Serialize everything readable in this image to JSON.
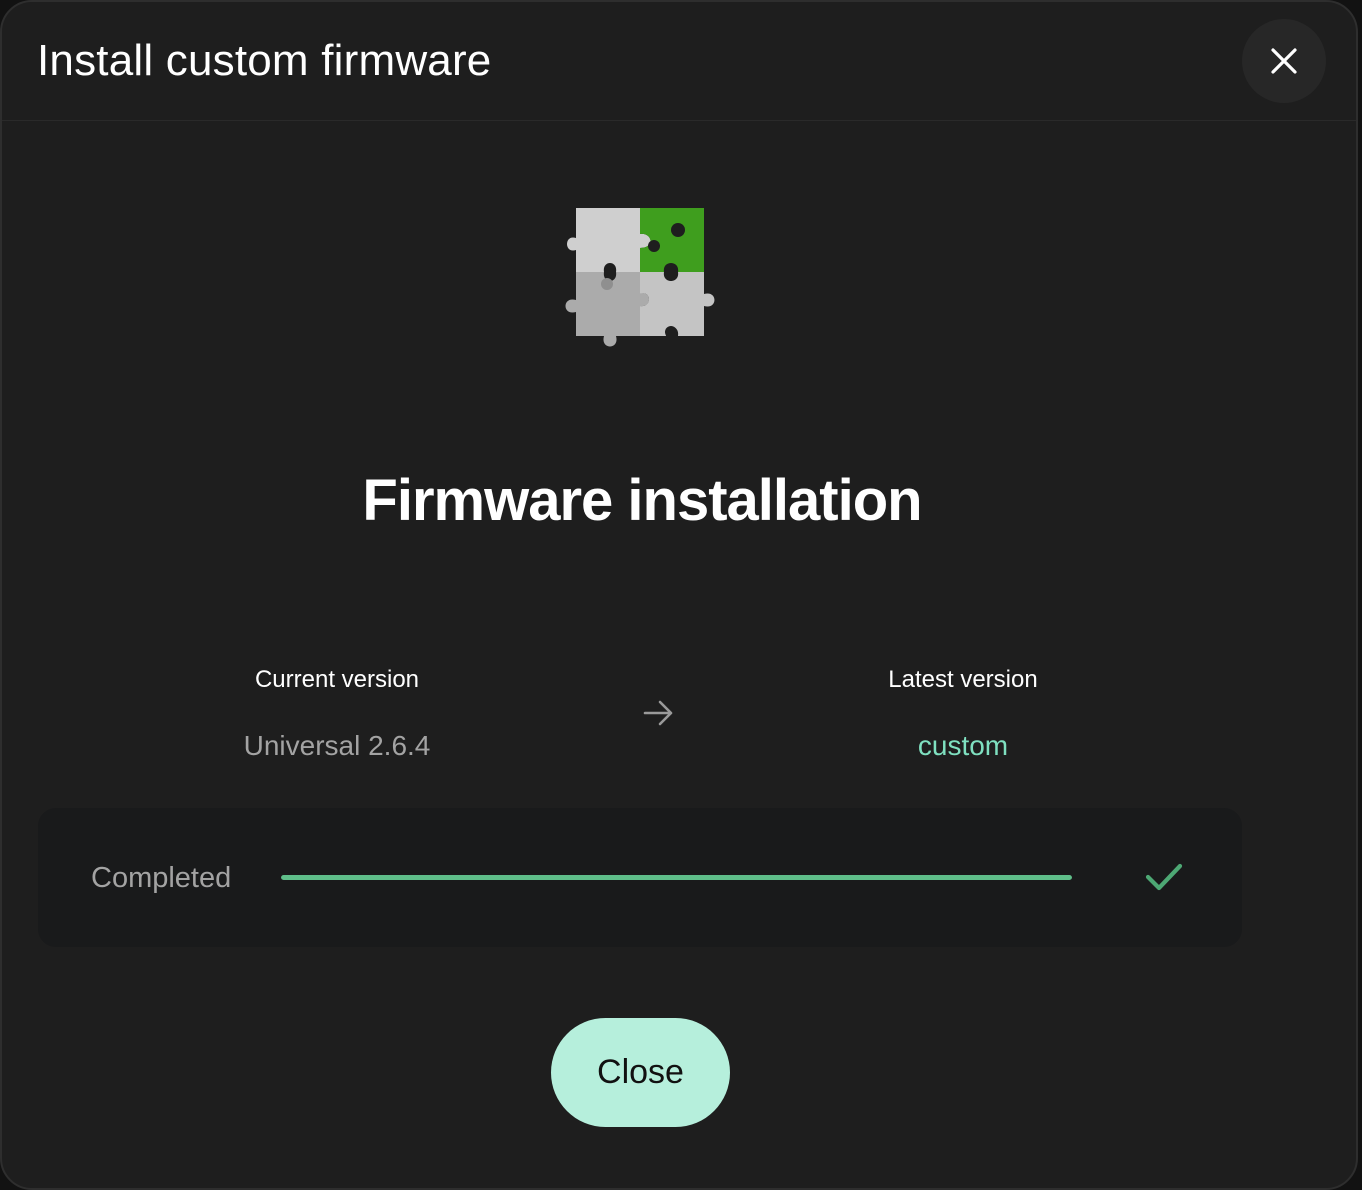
{
  "dialog": {
    "title": "Install custom firmware",
    "close_icon": "close-icon"
  },
  "illustration": {
    "icon": "puzzle-pieces-icon",
    "colors": {
      "gray": "#c9c9c9",
      "green": "#3f9e1e"
    }
  },
  "heading": "Firmware installation",
  "versions": {
    "current_label": "Current version",
    "current_value": "Universal 2.6.4",
    "arrow_icon": "arrow-right-icon",
    "latest_label": "Latest version",
    "latest_value": "custom"
  },
  "progress": {
    "label": "Completed",
    "fraction": 1.0,
    "status_icon": "checkmark-icon"
  },
  "footer": {
    "close_label": "Close"
  },
  "colors": {
    "accent": "#b6efdc",
    "success": "#5fbf8a",
    "latest_text": "#7fe0c0",
    "background": "#1e1e1e"
  }
}
